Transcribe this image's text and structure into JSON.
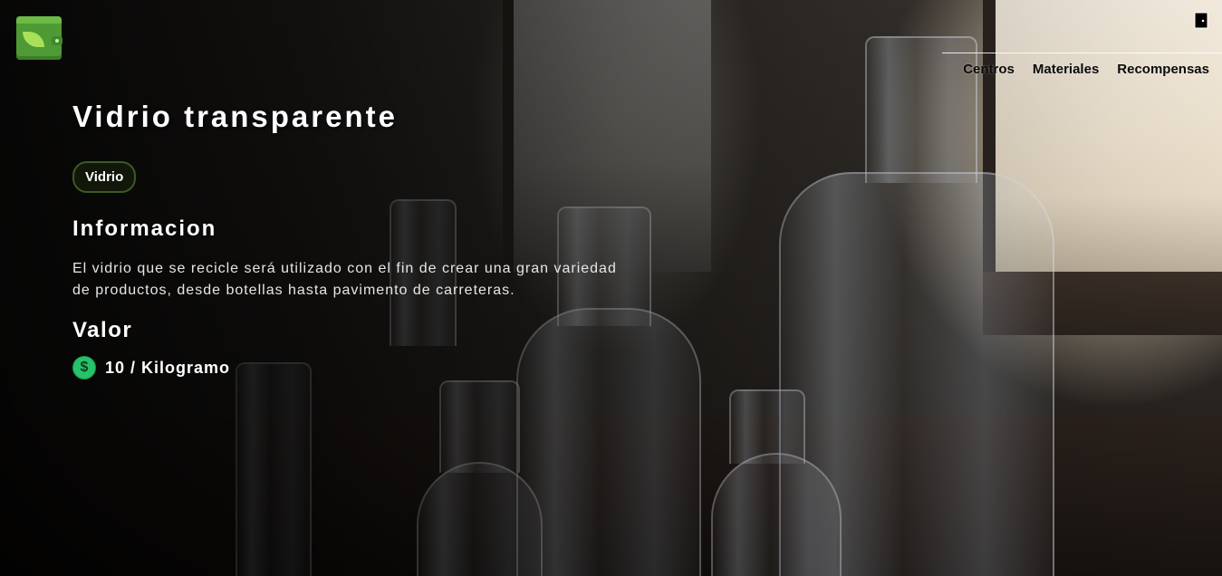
{
  "header": {
    "logo_icon": "wallet-leaf-icon",
    "logout_icon": "door-icon",
    "nav": [
      {
        "label": "Centros"
      },
      {
        "label": "Materiales"
      },
      {
        "label": "Recompensas"
      }
    ]
  },
  "material": {
    "title": "Vidrio transparente",
    "category": "Vidrio",
    "info_heading": "Informacion",
    "description": "El vidrio que se recicle será utilizado con el fin de crear una gran variedad de productos, desde botellas hasta pavimento de carreteras.",
    "value_heading": "Valor",
    "value_icon": "dollar-coin-icon",
    "value_text": "10 / Kilogramo"
  },
  "colors": {
    "accent_green": "#4e9a34",
    "chip_border": "#3c5a22",
    "coin_green": "#27c269"
  }
}
